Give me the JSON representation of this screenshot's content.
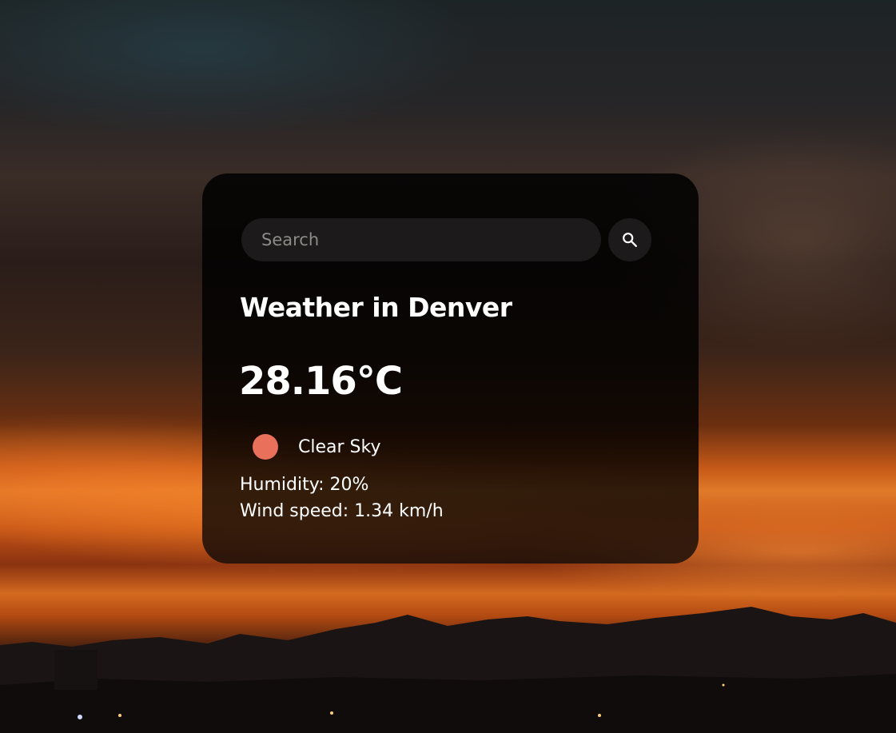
{
  "search": {
    "placeholder": "Search",
    "value": ""
  },
  "weather": {
    "title": "Weather in Denver",
    "temperature": "28.16°C",
    "description": "Clear Sky",
    "humidity": "Humidity: 20%",
    "wind": "Wind speed: 1.34 km/h"
  },
  "icons": {
    "search_button": "search-icon",
    "condition": "clear-sky-icon"
  },
  "colors": {
    "condition_icon": "#e9705a",
    "card_background": "#000000",
    "input_background": "#1c1a1a",
    "text": "#ffffff"
  }
}
